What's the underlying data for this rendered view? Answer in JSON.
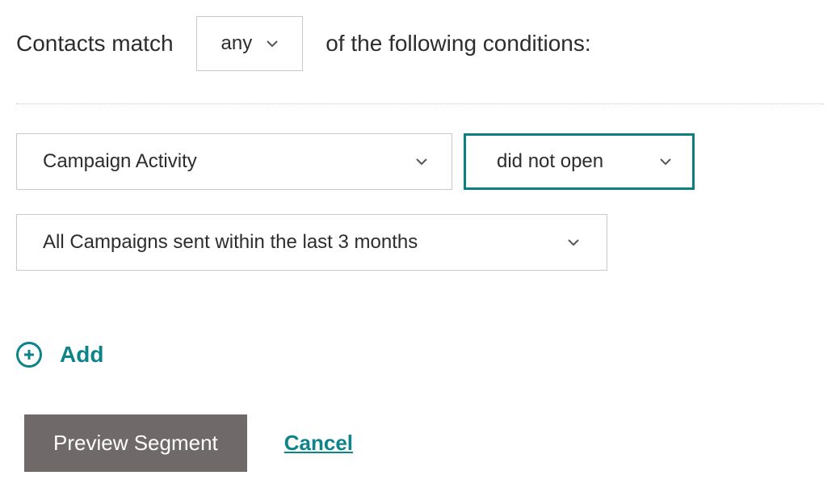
{
  "match": {
    "prefix": "Contacts match",
    "selector_value": "any",
    "suffix": "of the following conditions:"
  },
  "condition": {
    "field": "Campaign Activity",
    "operator": "did not open",
    "scope": "All Campaigns sent within the last 3 months"
  },
  "add_label": "Add",
  "actions": {
    "preview": "Preview Segment",
    "cancel": "Cancel"
  },
  "colors": {
    "accent": "#0d8489",
    "button": "#6f6a69",
    "border": "#c9c9c9"
  }
}
